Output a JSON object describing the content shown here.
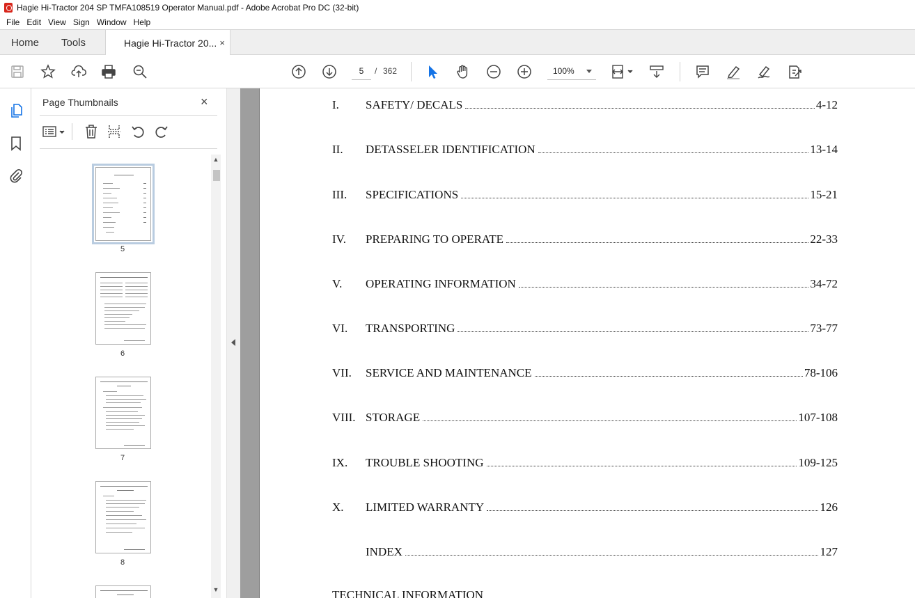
{
  "window": {
    "title": "Hagie Hi-Tractor 204 SP TMFA108519 Operator Manual.pdf - Adobe Acrobat Pro DC (32-bit)"
  },
  "menu": [
    "File",
    "Edit",
    "View",
    "Sign",
    "Window",
    "Help"
  ],
  "tabs": {
    "home": "Home",
    "tools": "Tools",
    "document": "Hagie Hi-Tractor 20...",
    "close_glyph": "×"
  },
  "toolbar": {
    "current_page": "5",
    "separator": "/",
    "total_pages": "362",
    "zoom": "100%",
    "icons": [
      "save-icon",
      "bookmark-star-icon",
      "upload-cloud-icon",
      "print-icon",
      "search-zoom-icon",
      "page-up-icon",
      "page-down-icon",
      "select-cursor-icon",
      "hand-tool-icon",
      "zoom-out-icon",
      "zoom-in-icon",
      "fit-page-icon",
      "scroll-mode-icon",
      "comment-icon",
      "highlight-icon",
      "fill-sign-icon",
      "export-icon"
    ]
  },
  "sidebar": {
    "panel_title": "Page Thumbnails",
    "close_glyph": "×",
    "thumbnails": [
      {
        "label": "5",
        "selected": true
      },
      {
        "label": "6",
        "selected": false
      },
      {
        "label": "7",
        "selected": false
      },
      {
        "label": "8",
        "selected": false
      }
    ]
  },
  "document": {
    "toc": [
      {
        "num": "I.",
        "title": "SAFETY/ DECALS",
        "pages": "4-12"
      },
      {
        "num": "II.",
        "title": "DETASSELER IDENTIFICATION",
        "pages": "13-14"
      },
      {
        "num": "III.",
        "title": "SPECIFICATIONS",
        "pages": "15-21"
      },
      {
        "num": "IV.",
        "title": "PREPARING TO OPERATE",
        "pages": "22-33"
      },
      {
        "num": "V.",
        "title": "OPERATING INFORMATION",
        "pages": "34-72"
      },
      {
        "num": "VI.",
        "title": "TRANSPORTING",
        "pages": "73-77"
      },
      {
        "num": "VII.",
        "title": "SERVICE AND MAINTENANCE",
        "pages": "78-106"
      },
      {
        "num": "VIII.",
        "title": "STORAGE",
        "pages": "107-108"
      },
      {
        "num": "IX.",
        "title": "TROUBLE SHOOTING",
        "pages": "109-125"
      },
      {
        "num": "X.",
        "title": "LIMITED WARRANTY",
        "pages": "126"
      },
      {
        "num": "",
        "title": "INDEX",
        "pages": "127"
      }
    ],
    "trailing_heading": "TECHNICAL INFORMATION"
  }
}
